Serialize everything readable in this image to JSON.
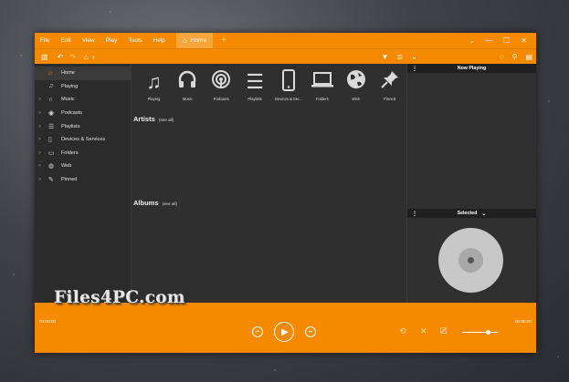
{
  "menu": [
    "File",
    "Edit",
    "View",
    "Play",
    "Tools",
    "Help"
  ],
  "tabs": {
    "home_label": "Home",
    "add_label": "+"
  },
  "window_controls": {
    "dropdown": "⌄",
    "minimize": "—",
    "maximize": "☐",
    "close": "✕"
  },
  "sidebar": {
    "items": [
      {
        "label": "Home",
        "icon": "home-icon",
        "expand": ""
      },
      {
        "label": "Playing",
        "icon": "music-note-icon",
        "expand": ""
      },
      {
        "label": "Music",
        "icon": "headphones-icon",
        "expand": ">"
      },
      {
        "label": "Podcasts",
        "icon": "podcast-icon",
        "expand": ">"
      },
      {
        "label": "Playlists",
        "icon": "list-icon",
        "expand": ">"
      },
      {
        "label": "Devices & Services",
        "icon": "phone-icon",
        "expand": ">"
      },
      {
        "label": "Folders",
        "icon": "laptop-icon",
        "expand": ">"
      },
      {
        "label": "Web",
        "icon": "globe-icon",
        "expand": ">"
      },
      {
        "label": "Pinned",
        "icon": "pin-icon",
        "expand": ">"
      }
    ]
  },
  "categories": [
    {
      "label": "Playing",
      "glyph": "♫"
    },
    {
      "label": "Music",
      "glyph": "🎧"
    },
    {
      "label": "Podcasts",
      "glyph": "◉"
    },
    {
      "label": "Playlists",
      "glyph": "☰"
    },
    {
      "label": "Devices & Ser...",
      "glyph": "▯"
    },
    {
      "label": "Folders",
      "glyph": "💻"
    },
    {
      "label": "Web",
      "glyph": "🌐"
    },
    {
      "label": "Pinned",
      "glyph": "📌"
    }
  ],
  "sections": {
    "artists": "Artists",
    "albums": "Albums",
    "see_all": "(see all)"
  },
  "right_panel": {
    "now_playing": "Now Playing",
    "selected": "Selected"
  },
  "player": {
    "time_left": "00:00:00",
    "time_right": "00:00:00",
    "volume_fraction": 0.72
  },
  "watermark": "Files4PC.com",
  "colors": {
    "accent": "#f58a00",
    "panel": "#2d2d2d"
  }
}
